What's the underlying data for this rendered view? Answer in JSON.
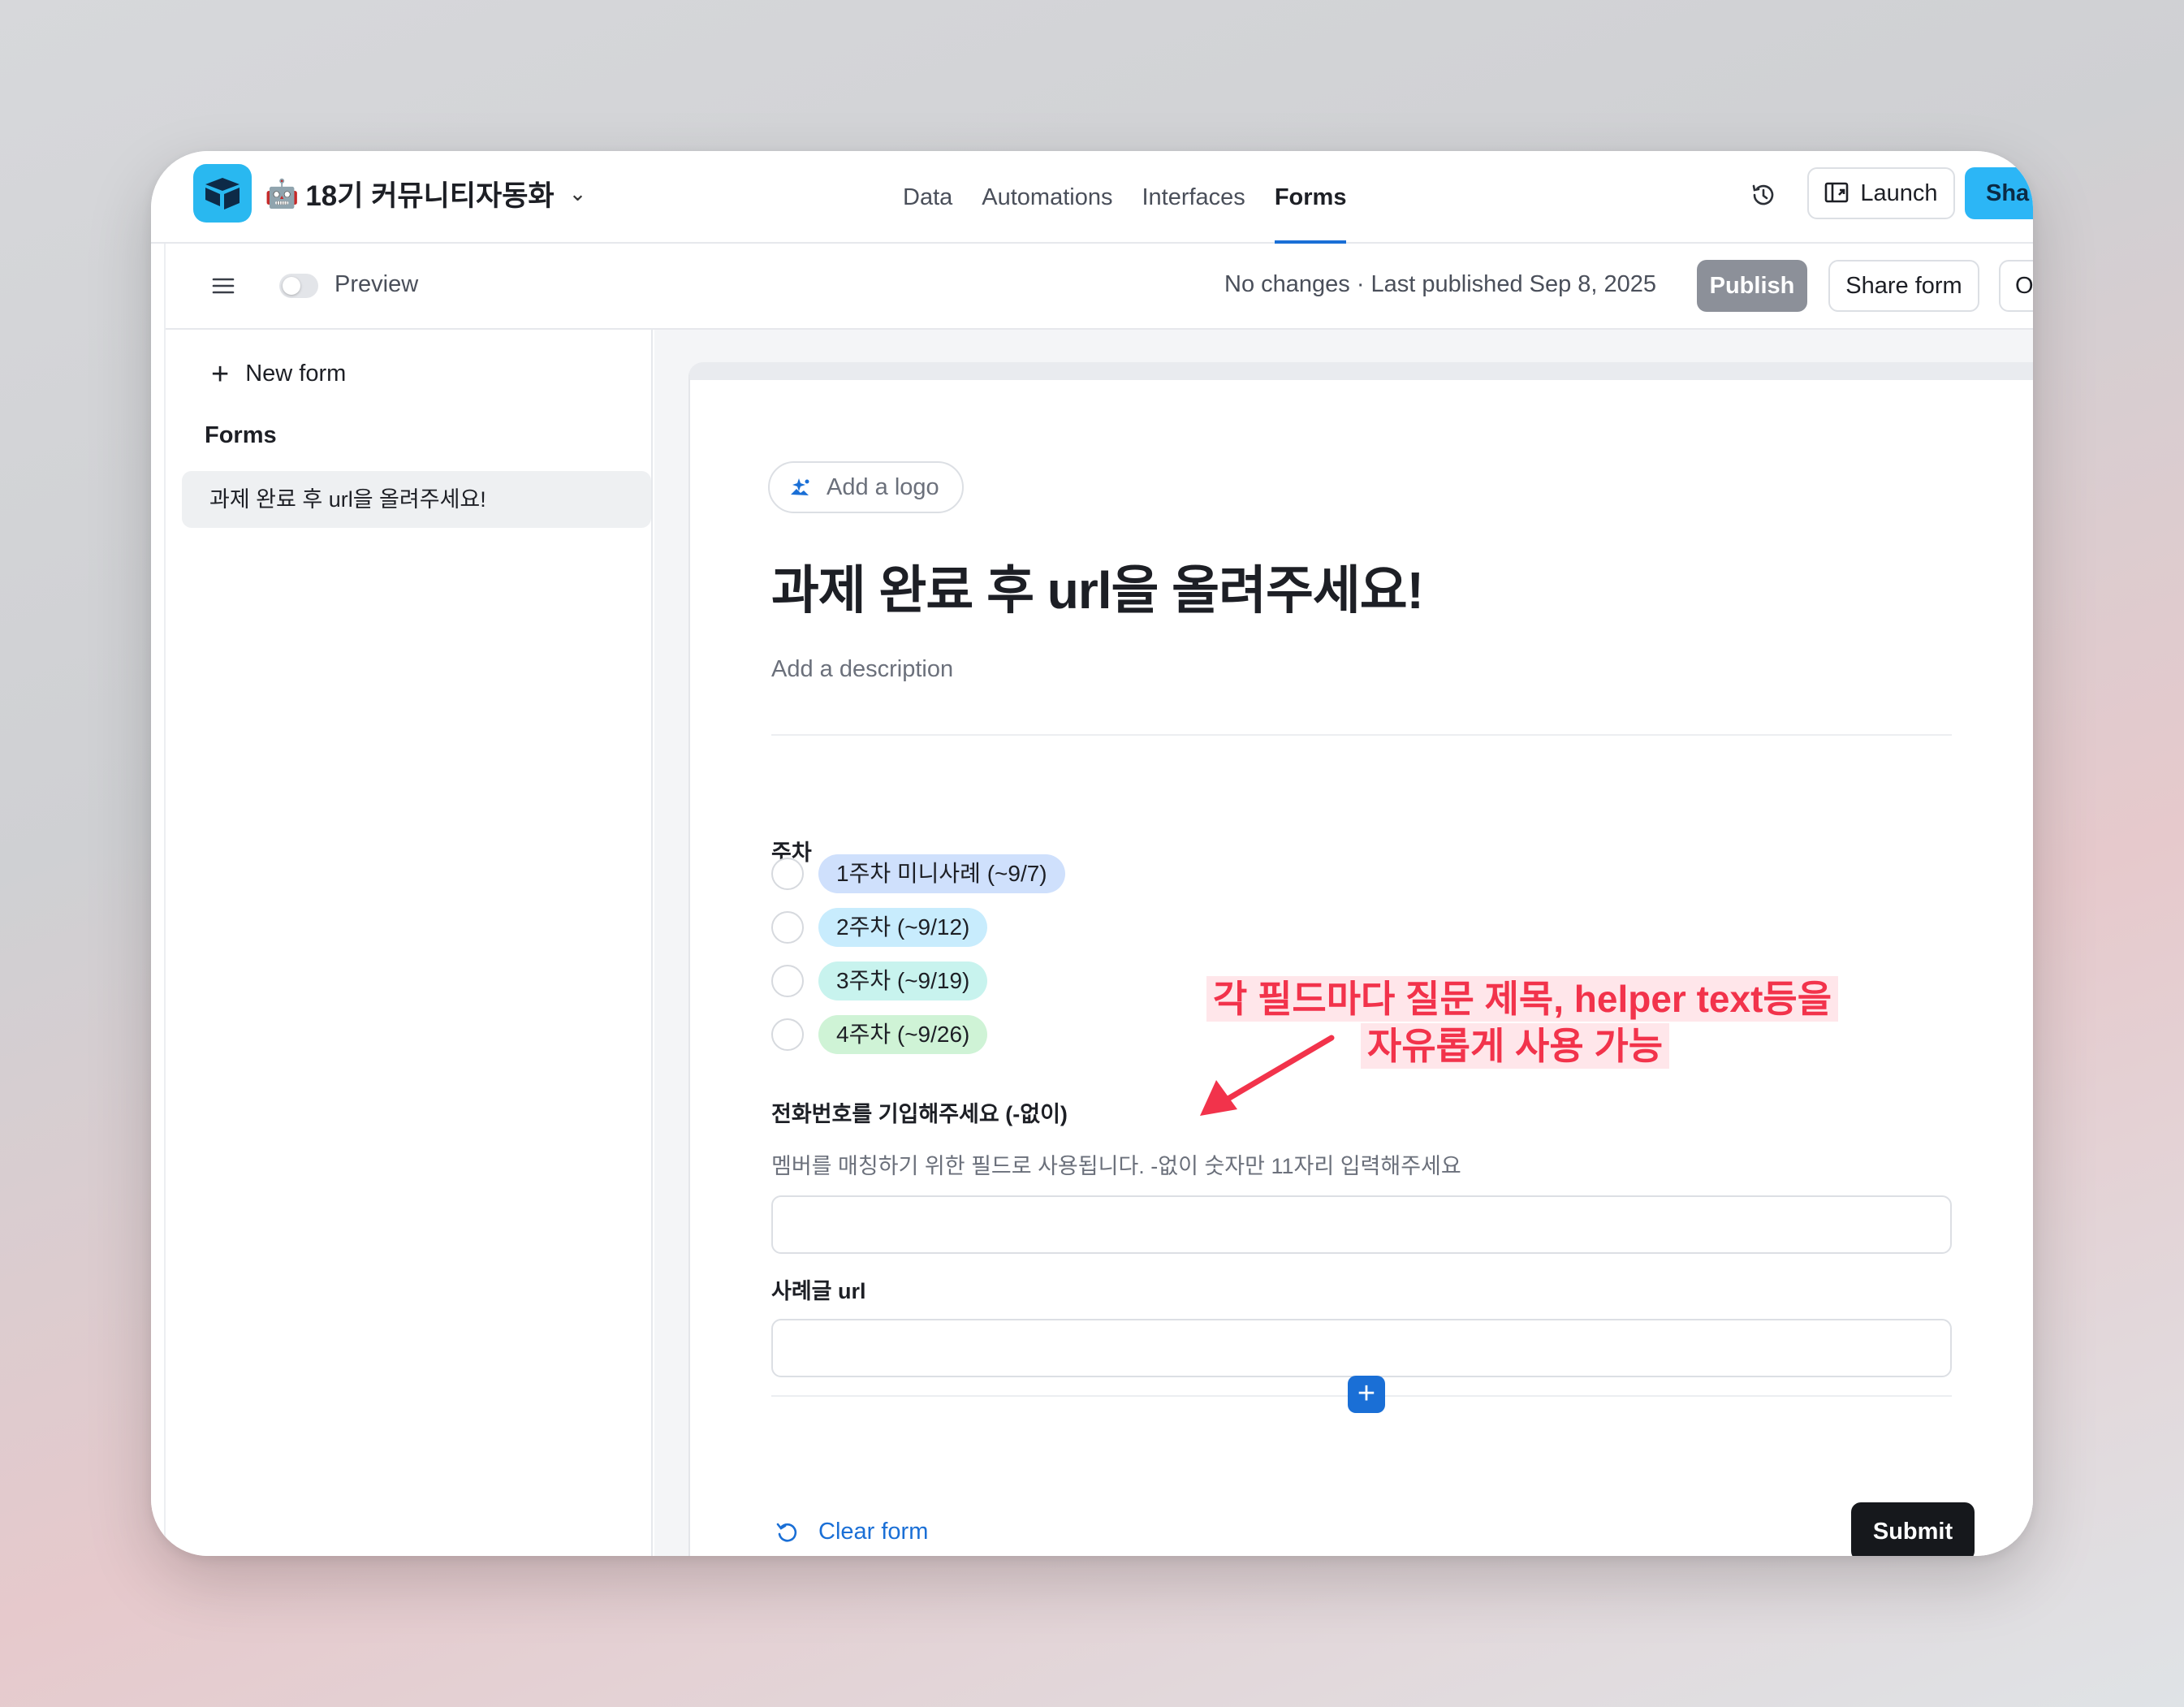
{
  "topbar": {
    "base_emoji": "🤖",
    "base_name": "18기 커뮤니티자동화",
    "nav": [
      "Data",
      "Automations",
      "Interfaces",
      "Forms"
    ],
    "active_nav": "Forms",
    "launch_label": "Launch",
    "share_label": "Sha"
  },
  "subbar": {
    "preview_label": "Preview",
    "status_text": "No changes · Last published Sep 8, 2025",
    "publish_label": "Publish",
    "share_form_label": "Share form",
    "open_label": "Op"
  },
  "sidebar": {
    "new_form_label": "New form",
    "forms_heading": "Forms",
    "items": [
      {
        "label": "과제 완료 후 url을 올려주세요!"
      }
    ]
  },
  "form": {
    "add_logo_label": "Add a logo",
    "title": "과제 완료 후 url을 올려주세요!",
    "description_placeholder": "Add a description",
    "fields": [
      {
        "label": "주차",
        "options": [
          {
            "label": "1주차 미니사례 (~9/7)",
            "color": "#cfe0fc"
          },
          {
            "label": "2주차 (~9/12)",
            "color": "#c8ecfd"
          },
          {
            "label": "3주차 (~9/19)",
            "color": "#c8f3ee"
          },
          {
            "label": "4주차 (~9/26)",
            "color": "#cff3d6"
          }
        ]
      },
      {
        "label": "전화번호를 기입해주세요 (-없이)",
        "helper": "멤버를 매칭하기 위한 필드로 사용됩니다. -없이 숫자만 11자리 입력해주세요"
      },
      {
        "label": "사례글 url"
      }
    ],
    "clear_label": "Clear form",
    "submit_label": "Submit"
  },
  "annotation": {
    "line1": "각 필드마다 질문 제목, helper text등을",
    "line2": "자유롭게 사용 가능",
    "color": "#f2334b"
  },
  "colors": {
    "accent": "#1a6fd6",
    "brand": "#29b8f0",
    "share": "#2cb6f6",
    "publish_disabled": "#8c9099"
  }
}
